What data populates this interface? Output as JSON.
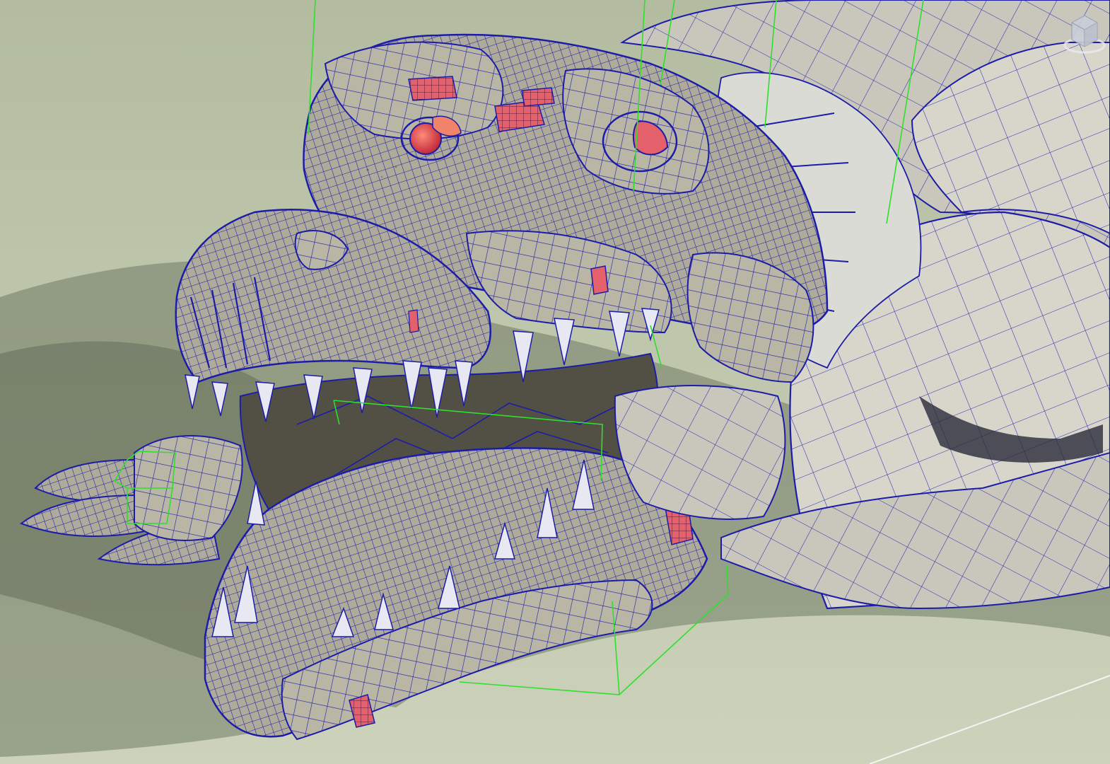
{
  "viewport": {
    "model": "mechanical-crocodile",
    "display_mode": "wireframe-on-shaded",
    "colors": {
      "background": "#b9c2a8",
      "floor_shadow": "#6f7a63",
      "surface": "#b9b6a6",
      "surface_light": "#d6d3c4",
      "surface_dark": "#8e8b7d",
      "wire": "#1c1ca8",
      "accent_red": "#e4606a",
      "accent_orange": "#f0846a",
      "bbox_green": "#2ee02e",
      "tooth": "#e8e8f2",
      "grid_line": "#f4f4f4"
    }
  },
  "view_cube": {
    "icon": "view-cube-icon",
    "home_icon": "view-cube-ring-icon"
  }
}
